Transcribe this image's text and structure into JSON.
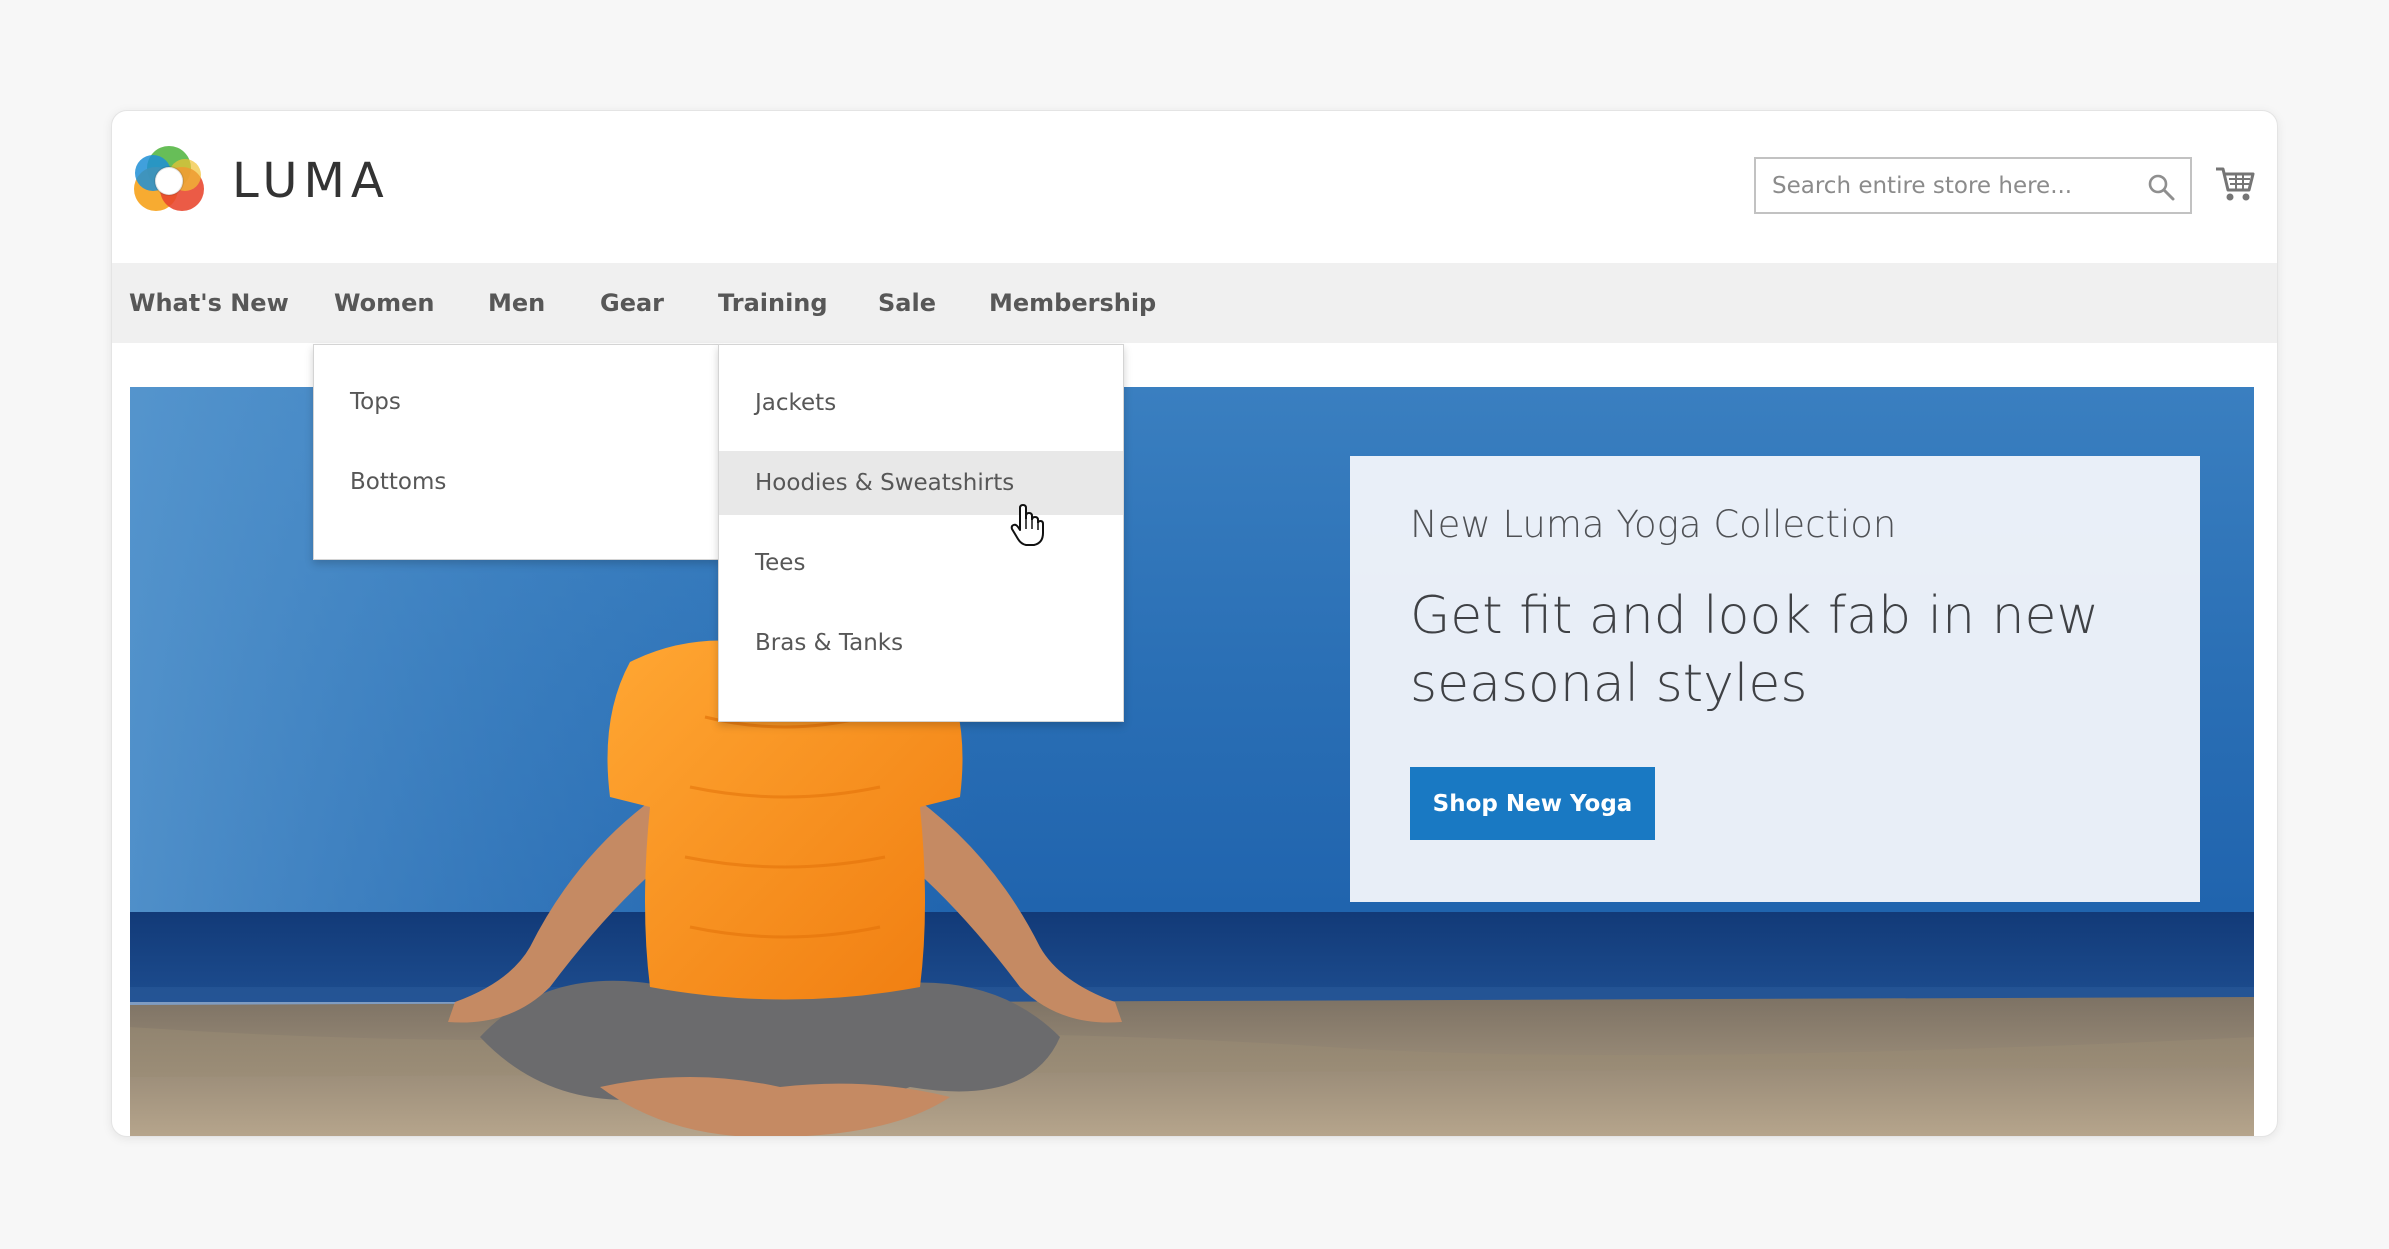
{
  "header": {
    "logo_text": "LUMA",
    "search": {
      "placeholder": "Search entire store here...",
      "value": ""
    },
    "icons": {
      "search": "search-icon",
      "cart": "cart-icon",
      "logo": "luma-logo-icon"
    }
  },
  "nav": {
    "items": [
      {
        "label": "What's New"
      },
      {
        "label": "Women"
      },
      {
        "label": "Men"
      },
      {
        "label": "Gear"
      },
      {
        "label": "Training"
      },
      {
        "label": "Sale"
      },
      {
        "label": "Membership"
      }
    ]
  },
  "women_menu": {
    "items": [
      {
        "label": "Tops"
      },
      {
        "label": "Bottoms"
      }
    ]
  },
  "tops_menu": {
    "items": [
      {
        "label": "Jackets"
      },
      {
        "label": "Hoodies & Sweatshirts",
        "hovered": true
      },
      {
        "label": "Tees"
      },
      {
        "label": "Bras & Tanks"
      }
    ]
  },
  "hero": {
    "kicker": "New Luma Yoga Collection",
    "title": "Get fit and look fab in new seasonal styles",
    "cta_label": "Shop New Yoga"
  },
  "colors": {
    "accent": "#1979c3",
    "nav_bg": "#f0f0f0",
    "text": "#575757"
  }
}
